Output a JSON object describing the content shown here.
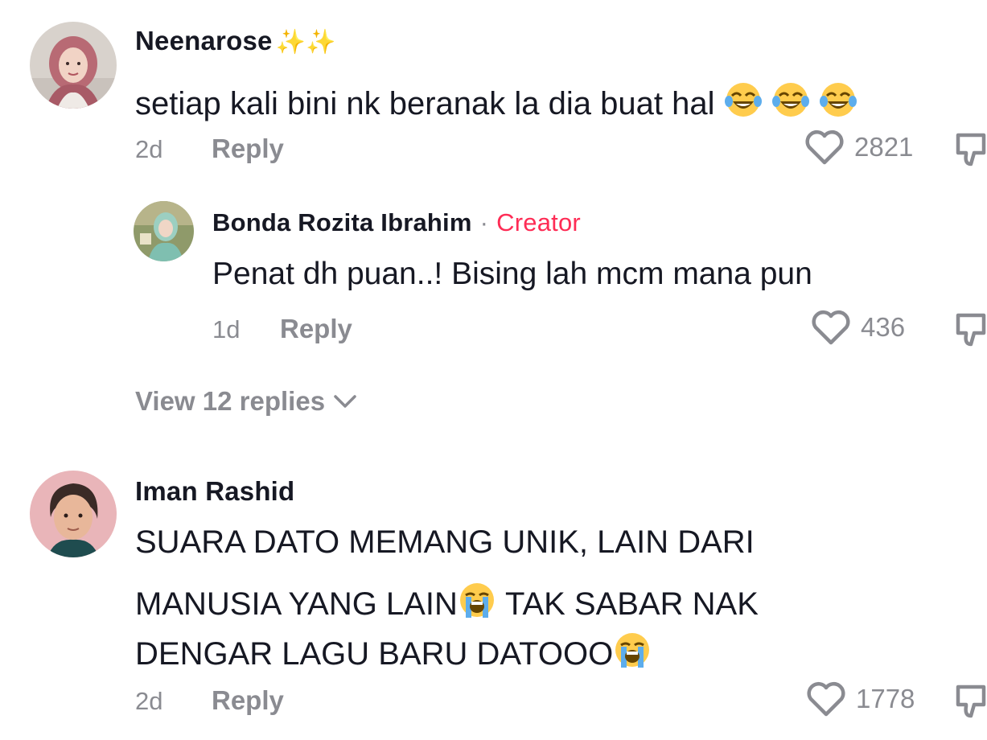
{
  "comments": [
    {
      "username": "Neenarose",
      "username_suffix": "✨✨",
      "text": "setiap kali bini nk beranak la dia buat hal",
      "text_emoji": "face-with-tears-of-joy x3",
      "time": "2d",
      "reply_label": "Reply",
      "likes": "2821"
    },
    {
      "username": "Iman Rashid",
      "text_line1": "SUARA DATO MEMANG UNIK, LAIN DARI",
      "text_line2a": "MANUSIA YANG LAIN",
      "text_line2b": "TAK SABAR NAK",
      "text_line3": "DENGAR LAGU BARU DATOOO",
      "text_emoji": "loudly-crying-face",
      "time": "2d",
      "reply_label": "Reply",
      "likes": "1778"
    }
  ],
  "reply": {
    "username": "Bonda Rozita Ibrahim",
    "separator": "·",
    "badge": "Creator",
    "text": "Penat dh puan..! Bising lah mcm mana pun",
    "time": "1d",
    "reply_label": "Reply",
    "likes": "436"
  },
  "view_replies": {
    "label": "View",
    "count_label": "12 replies"
  },
  "colors": {
    "text": "#161823",
    "muted": "#8a8b91",
    "creator": "#fe2c55"
  },
  "icons": [
    "heart-outline-icon",
    "dislike-icon",
    "chevron-down-icon",
    "sparkles-icon",
    "face-with-tears-of-joy-emoji",
    "loudly-crying-face-emoji"
  ]
}
